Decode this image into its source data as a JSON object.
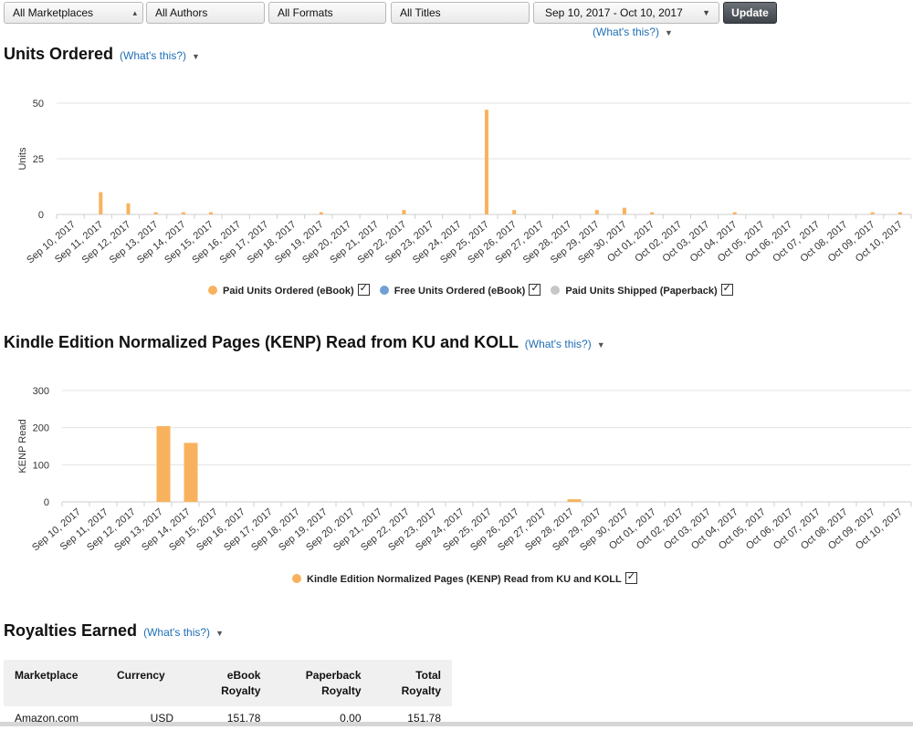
{
  "filters": {
    "marketplace": "All Marketplaces",
    "authors": "All Authors",
    "formats": "All Formats",
    "titles": "All Titles",
    "date_range": "Sep 10, 2017 - Oct 10, 2017",
    "update_label": "Update",
    "whats_this": "(What's this?)"
  },
  "units_section": {
    "title": "Units Ordered",
    "whats_this": "(What's this?)",
    "legend": [
      {
        "label": "Paid Units Ordered (eBook)",
        "color": "#f8b25d"
      },
      {
        "label": "Free Units Ordered (eBook)",
        "color": "#6fa1d6"
      },
      {
        "label": "Paid Units Shipped (Paperback)",
        "color": "#c6c6c6"
      }
    ]
  },
  "kenp_section": {
    "title": "Kindle Edition Normalized Pages (KENP) Read from KU and KOLL",
    "whats_this": "(What's this?)",
    "legend": [
      {
        "label": "Kindle Edition Normalized Pages (KENP) Read from KU and KOLL",
        "color": "#f8b25d"
      }
    ]
  },
  "royalties_section": {
    "title": "Royalties Earned",
    "whats_this": "(What's this?)",
    "columns": [
      {
        "line1": "Marketplace",
        "line2": ""
      },
      {
        "line1": "Currency",
        "line2": ""
      },
      {
        "line1": "eBook",
        "line2": "Royalty"
      },
      {
        "line1": "Paperback",
        "line2": "Royalty"
      },
      {
        "line1": "Total",
        "line2": "Royalty"
      }
    ],
    "rows": [
      {
        "marketplace": "Amazon.com",
        "currency": "USD",
        "ebook": "151.78",
        "paperback": "0.00",
        "total": "151.78"
      }
    ]
  },
  "chart_data": [
    {
      "type": "bar",
      "title": "Units Ordered",
      "ylabel": "Units",
      "ylim": [
        0,
        50
      ],
      "yticks": [
        0,
        25,
        50
      ],
      "grid": true,
      "legend_position": "bottom",
      "categories": [
        "Sep 10, 2017",
        "Sep 11, 2017",
        "Sep 12, 2017",
        "Sep 13, 2017",
        "Sep 14, 2017",
        "Sep 15, 2017",
        "Sep 16, 2017",
        "Sep 17, 2017",
        "Sep 18, 2017",
        "Sep 19, 2017",
        "Sep 20, 2017",
        "Sep 21, 2017",
        "Sep 22, 2017",
        "Sep 23, 2017",
        "Sep 24, 2017",
        "Sep 25, 2017",
        "Sep 26, 2017",
        "Sep 27, 2017",
        "Sep 28, 2017",
        "Sep 29, 2017",
        "Sep 30, 2017",
        "Oct 01, 2017",
        "Oct 02, 2017",
        "Oct 03, 2017",
        "Oct 04, 2017",
        "Oct 05, 2017",
        "Oct 06, 2017",
        "Oct 07, 2017",
        "Oct 08, 2017",
        "Oct 09, 2017",
        "Oct 10, 2017"
      ],
      "series": [
        {
          "name": "Paid Units Ordered (eBook)",
          "color": "#f8b25d",
          "values": [
            0,
            10,
            5,
            1,
            1,
            1,
            0,
            0,
            0,
            1,
            0,
            0,
            2,
            0,
            0,
            47,
            2,
            0,
            0,
            2,
            3,
            1,
            0,
            0,
            1,
            0,
            0,
            0,
            0,
            1,
            1
          ]
        },
        {
          "name": "Free Units Ordered (eBook)",
          "color": "#6fa1d6",
          "values": [
            0,
            0,
            0,
            0,
            0,
            0,
            0,
            0,
            0,
            0,
            0,
            0,
            0,
            0,
            0,
            0,
            0,
            0,
            0,
            0,
            0,
            0,
            0,
            0,
            0,
            0,
            0,
            0,
            0,
            0,
            0
          ]
        },
        {
          "name": "Paid Units Shipped (Paperback)",
          "color": "#c6c6c6",
          "values": [
            0,
            0,
            0,
            0,
            0,
            0,
            0,
            0,
            0,
            0,
            0,
            0,
            0,
            0,
            0,
            0,
            0,
            0,
            0,
            0,
            0,
            0,
            0,
            0,
            0,
            0,
            0,
            0,
            0,
            0,
            0
          ]
        }
      ]
    },
    {
      "type": "bar",
      "title": "Kindle Edition Normalized Pages (KENP) Read from KU and KOLL",
      "ylabel": "KENP Read",
      "ylim": [
        0,
        300
      ],
      "yticks": [
        0,
        100,
        200,
        300
      ],
      "grid": true,
      "legend_position": "bottom",
      "categories": [
        "Sep 10, 2017",
        "Sep 11, 2017",
        "Sep 12, 2017",
        "Sep 13, 2017",
        "Sep 14, 2017",
        "Sep 15, 2017",
        "Sep 16, 2017",
        "Sep 17, 2017",
        "Sep 18, 2017",
        "Sep 19, 2017",
        "Sep 20, 2017",
        "Sep 21, 2017",
        "Sep 22, 2017",
        "Sep 23, 2017",
        "Sep 24, 2017",
        "Sep 25, 2017",
        "Sep 26, 2017",
        "Sep 27, 2017",
        "Sep 28, 2017",
        "Sep 29, 2017",
        "Sep 30, 2017",
        "Oct 01, 2017",
        "Oct 02, 2017",
        "Oct 03, 2017",
        "Oct 04, 2017",
        "Oct 05, 2017",
        "Oct 06, 2017",
        "Oct 07, 2017",
        "Oct 08, 2017",
        "Oct 09, 2017",
        "Oct 10, 2017"
      ],
      "series": [
        {
          "name": "Kindle Edition Normalized Pages (KENP) Read from KU and KOLL",
          "color": "#f8b25d",
          "values": [
            0,
            0,
            0,
            204,
            159,
            0,
            0,
            0,
            0,
            0,
            0,
            0,
            0,
            0,
            0,
            0,
            0,
            0,
            7,
            0,
            0,
            0,
            0,
            0,
            0,
            0,
            0,
            0,
            0,
            0,
            0
          ]
        }
      ]
    }
  ]
}
